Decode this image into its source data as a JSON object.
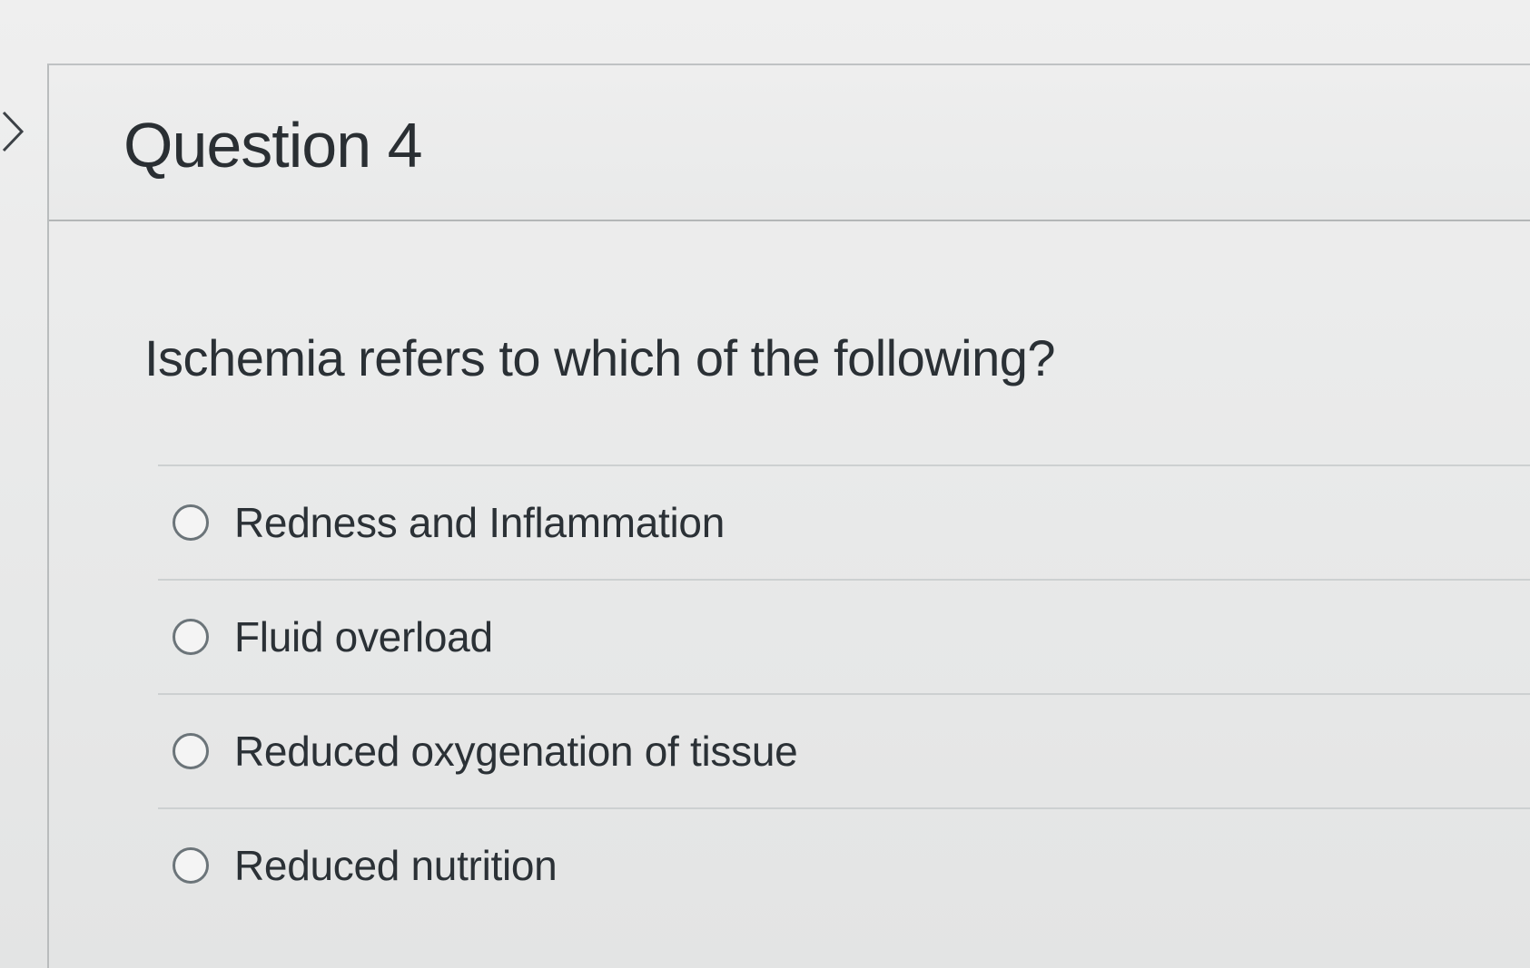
{
  "question": {
    "title": "Question 4",
    "text": "Ischemia refers to which of the following?",
    "options": [
      {
        "label": "Redness and Inflammation"
      },
      {
        "label": "Fluid overload"
      },
      {
        "label": "Reduced oxygenation of tissue"
      },
      {
        "label": "Reduced nutrition"
      }
    ]
  },
  "icons": {
    "collapse": "chevron-right-icon",
    "option": "radio-button-icon"
  }
}
